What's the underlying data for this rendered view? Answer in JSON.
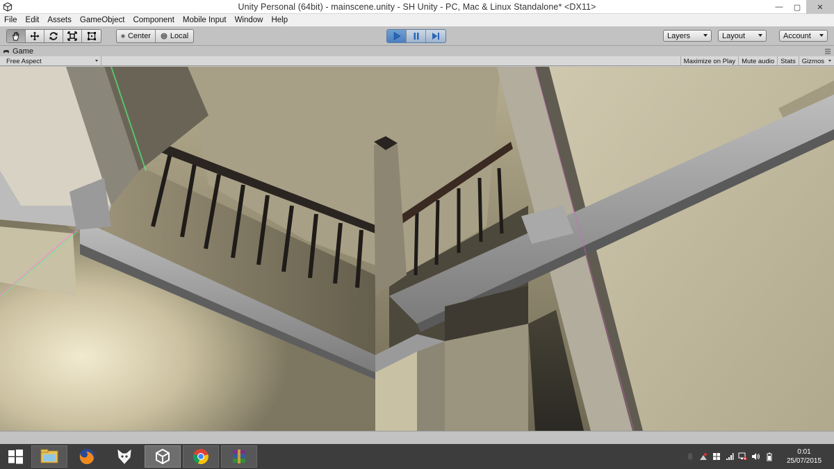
{
  "window": {
    "title": "Unity Personal (64bit) - mainscene.unity - SH Unity - PC, Mac & Linux Standalone* <DX11>",
    "controls": {
      "minimize": "—",
      "maximize": "▢",
      "close": "✕"
    }
  },
  "menu": {
    "items": [
      "File",
      "Edit",
      "Assets",
      "GameObject",
      "Component",
      "Mobile Input",
      "Window",
      "Help"
    ]
  },
  "toolbar": {
    "tools": [
      {
        "icon": "hand-icon",
        "active": true
      },
      {
        "icon": "move-icon",
        "active": false
      },
      {
        "icon": "rotate-icon",
        "active": false
      },
      {
        "icon": "scale-icon",
        "active": false
      },
      {
        "icon": "rect-tool-icon",
        "active": false
      }
    ],
    "pivot_label": "Center",
    "space_label": "Local",
    "playback": {
      "play_active": true,
      "pause_active": false
    },
    "layers_label": "Layers",
    "layout_label": "Layout",
    "account_label": "Account"
  },
  "game_view": {
    "tab_label": "Game",
    "aspect_label": "Free Aspect",
    "maximize_label": "Maximize on Play",
    "mute_label": "Mute audio",
    "stats_label": "Stats",
    "gizmos_label": "Gizmos"
  },
  "taskbar": {
    "apps": [
      {
        "name": "start-button",
        "state": "none"
      },
      {
        "name": "file-explorer",
        "state": "open"
      },
      {
        "name": "firefox",
        "state": "none"
      },
      {
        "name": "foobar",
        "state": "none"
      },
      {
        "name": "unity",
        "state": "active"
      },
      {
        "name": "chrome",
        "state": "open"
      },
      {
        "name": "winrar",
        "state": "open"
      }
    ],
    "clock": {
      "time": "0:01",
      "date": "25/07/2015"
    }
  },
  "colors": {
    "accent_play": "#4b80c1",
    "editor_bg": "#c2c2c2",
    "taskbar_bg": "#3d3d3d"
  }
}
